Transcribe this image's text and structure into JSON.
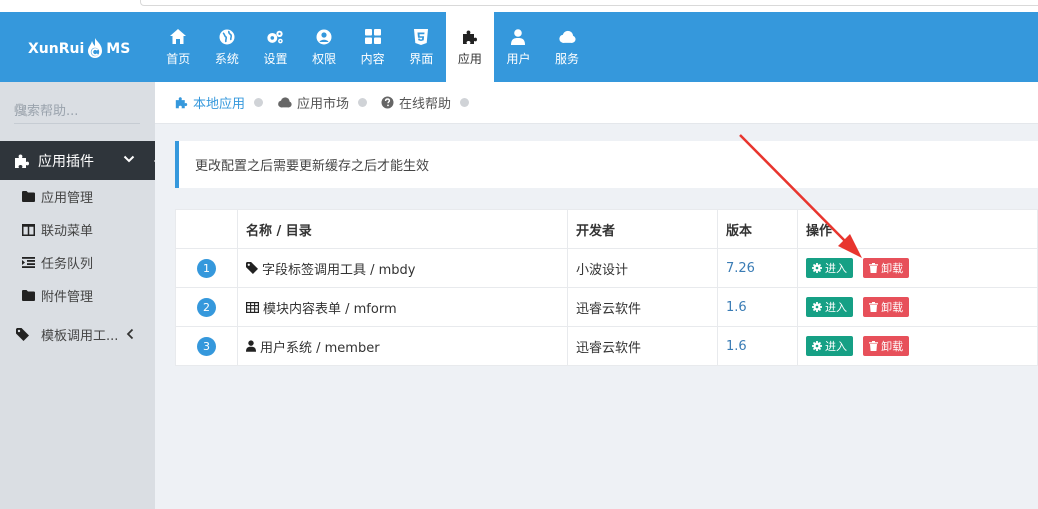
{
  "brand": {
    "logo_left": "XunRui",
    "logo_right": "MS"
  },
  "nav": [
    {
      "label": "首页",
      "icon": "home-icon"
    },
    {
      "label": "系统",
      "icon": "globe-icon"
    },
    {
      "label": "设置",
      "icon": "cogs-icon"
    },
    {
      "label": "权限",
      "icon": "user-circle-icon"
    },
    {
      "label": "内容",
      "icon": "th-large-icon"
    },
    {
      "label": "界面",
      "icon": "html5-icon"
    },
    {
      "label": "应用",
      "icon": "puzzle-icon",
      "active": true
    },
    {
      "label": "用户",
      "icon": "user-icon"
    },
    {
      "label": "服务",
      "icon": "cloud-icon"
    }
  ],
  "sidebar": {
    "search_placeholder": "搜索帮助...",
    "group_label": "应用插件",
    "items": [
      {
        "label": "应用管理",
        "icon": "folder-icon",
        "active": true
      },
      {
        "label": "联动菜单",
        "icon": "columns-icon"
      },
      {
        "label": "任务队列",
        "icon": "indent-icon"
      },
      {
        "label": "附件管理",
        "icon": "folder-icon"
      }
    ],
    "template_label": "模板调用工..."
  },
  "breadcrumb": [
    {
      "label": "本地应用",
      "icon": "puzzle-icon",
      "active": true
    },
    {
      "label": "应用市场",
      "icon": "cloud-icon"
    },
    {
      "label": "在线帮助",
      "icon": "question-circle-icon"
    }
  ],
  "alert": "更改配置之后需要更新缓存之后才能生效",
  "table": {
    "headers": [
      "",
      "名称 / 目录",
      "开发者",
      "版本",
      "操作"
    ],
    "rows": [
      {
        "num": "1",
        "icon": "tag-icon",
        "name": "字段标签调用工具 / mbdy",
        "developer": "小波设计",
        "version": "7.26"
      },
      {
        "num": "2",
        "icon": "table-icon",
        "name": "模块内容表单 / mform",
        "developer": "迅睿云软件",
        "version": "1.6"
      },
      {
        "num": "3",
        "icon": "user-icon",
        "name": "用户系统 / member",
        "developer": "迅睿云软件",
        "version": "1.6"
      }
    ],
    "enter_label": "进入",
    "uninstall_label": "卸载"
  },
  "colors": {
    "primary": "#3598dc",
    "sidebar_dark": "#2f353b",
    "enter": "#16a085",
    "uninstall": "#e7505a",
    "annotation_arrow": "#e8352e"
  }
}
